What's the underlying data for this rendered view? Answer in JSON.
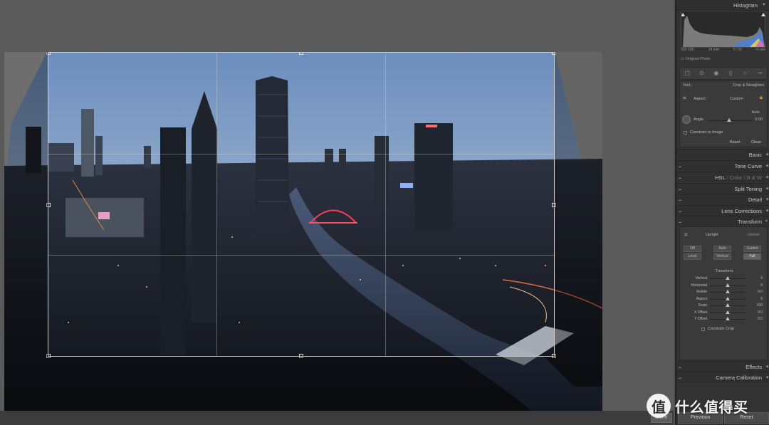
{
  "panel": {
    "histogram_title": "Histogram",
    "histogram_meta": [
      "ISO 100",
      "14 mm",
      "f / 10",
      "¼ sec"
    ],
    "original_photo": "Original Photo",
    "tools": [
      "crop-overlay-icon",
      "spot-removal-icon",
      "red-eye-icon",
      "graduated-filter-icon",
      "radial-filter-icon",
      "adjustment-brush-icon"
    ],
    "crop": {
      "tool_label": "Tool :",
      "tool_name": "Crop & Straighten",
      "aspect_label": "Aspect :",
      "aspect_value": "Custom",
      "auto_label": "Auto",
      "angle_label": "Angle",
      "angle_value": "0.00",
      "constrain_label": "Constrain to Image",
      "reset_label": "Reset",
      "close_label": "Close"
    },
    "sections": {
      "basic": "Basic",
      "tone_curve": "Tone Curve",
      "hsl_1": "HSL",
      "hsl_2": "Color",
      "hsl_3": "B & W",
      "split_toning": "Split Toning",
      "detail": "Detail",
      "lens_corrections": "Lens Corrections",
      "transform": "Transform",
      "effects": "Effects",
      "camera_calibration": "Camera Calibration"
    },
    "transform": {
      "upright_label": "Upright",
      "update_label": "Update",
      "buttons_row1": [
        "Off",
        "Auto",
        "Guided"
      ],
      "buttons_row2": [
        "Level",
        "Vertical",
        "Full"
      ],
      "transform_label": "Transform",
      "sliders": [
        {
          "label": "Vertical",
          "value": "0",
          "fraction": 0.5
        },
        {
          "label": "Horizontal",
          "value": "0",
          "fraction": 0.5
        },
        {
          "label": "Rotate",
          "value": "0.0",
          "fraction": 0.5
        },
        {
          "label": "Aspect",
          "value": "0",
          "fraction": 0.5
        },
        {
          "label": "Scale",
          "value": "100",
          "fraction": 0.5
        },
        {
          "label": "X Offset",
          "value": "0.0",
          "fraction": 0.5
        },
        {
          "label": "Y Offset",
          "value": "0.0",
          "fraction": 0.5
        }
      ],
      "constrain_crop": "Constrain Crop"
    },
    "nav": {
      "previous": "Previous",
      "reset": "Reset"
    }
  },
  "canvas": {
    "done_label": "Done"
  },
  "watermark": {
    "logo_char": "值",
    "text": "什么值得买"
  },
  "colors": {
    "panel_bg": "#333333",
    "canvas_bg": "#545454",
    "sky_top": "#6d8fbf",
    "sky_horizon": "#e8a878"
  }
}
